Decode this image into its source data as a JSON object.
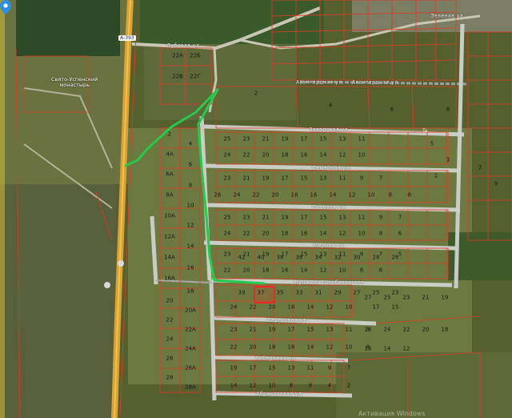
{
  "map": {
    "highway_label": "А-393",
    "monastery_label_line1": "Свято-Успенский",
    "monastery_label_line2": "монастырь",
    "watermark": "Активация Windows",
    "road_marker": "Ta",
    "route_color": "#27c94d",
    "parcel_color": "#e23a24",
    "highlight_color": "#ff2020",
    "pin_color": "#2b8fe6",
    "streets": [
      "Авангардная ул.",
      "Авангардная ул.",
      "Заводская ул.",
      "Семейная ул.",
      "Полевая ул.",
      "Мирная ул.",
      "Пушкина Щербаковская",
      "Береговая ул.",
      "Лебединая ул.",
      "Абрикосовая ул.",
      "Дубовая ул.",
      "Зеленая ул."
    ],
    "parcels": [
      "25",
      "23",
      "21",
      "19",
      "17",
      "15",
      "13",
      "11",
      "24",
      "22",
      "20",
      "18",
      "16",
      "14",
      "12",
      "10",
      "23",
      "21",
      "19",
      "17",
      "15",
      "13",
      "11",
      "9",
      "7",
      "26",
      "24",
      "22",
      "20",
      "18",
      "16",
      "14",
      "12",
      "10",
      "8",
      "6",
      "25",
      "23",
      "21",
      "19",
      "17",
      "15",
      "13",
      "11",
      "9",
      "7",
      "24",
      "22",
      "20",
      "18",
      "16",
      "14",
      "12",
      "10",
      "8",
      "6",
      "23",
      "21",
      "19",
      "17",
      "15",
      "13",
      "11",
      "9",
      "7",
      "5",
      "22",
      "20",
      "18",
      "16",
      "14",
      "12",
      "10",
      "8",
      "6",
      "42",
      "40",
      "38",
      "36",
      "34",
      "32",
      "30",
      "28",
      "26",
      "39",
      "37",
      "35",
      "33",
      "31",
      "29",
      "27",
      "25",
      "23",
      "24",
      "22",
      "20",
      "18",
      "14",
      "12",
      "10",
      "23",
      "21",
      "19",
      "17",
      "15",
      "13",
      "11",
      "9",
      "22",
      "20",
      "18",
      "16",
      "14",
      "12",
      "10",
      "8",
      "19",
      "17",
      "15",
      "13",
      "11",
      "9",
      "7",
      "14",
      "12",
      "10",
      "8",
      "6",
      "4",
      "2",
      "2",
      "4",
      "4А",
      "6",
      "6А",
      "8",
      "8А",
      "10",
      "10А",
      "12",
      "12А",
      "14",
      "14А",
      "16",
      "16А",
      "18",
      "20",
      "20А",
      "22",
      "22А",
      "24",
      "24А",
      "26",
      "26А",
      "28",
      "28А",
      "22А",
      "22Б",
      "22В",
      "22Г",
      "6",
      "4",
      "8",
      "2",
      "5",
      "3",
      "1",
      "7",
      "9",
      "27",
      "25",
      "23",
      "21",
      "19",
      "17",
      "15",
      "26",
      "24",
      "22",
      "20",
      "18",
      "16",
      "14",
      "12"
    ]
  }
}
